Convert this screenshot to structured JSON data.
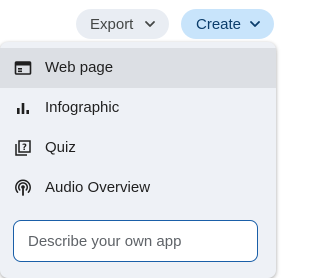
{
  "toolbar": {
    "export_label": "Export",
    "create_label": "Create"
  },
  "menu": {
    "items": [
      {
        "label": "Web page",
        "icon": "web-page-icon"
      },
      {
        "label": "Infographic",
        "icon": "bar-chart-icon"
      },
      {
        "label": "Quiz",
        "icon": "quiz-icon"
      },
      {
        "label": "Audio Overview",
        "icon": "podcast-icon"
      }
    ],
    "describe_placeholder": "Describe your own app"
  },
  "colors": {
    "create_bg": "#c8e4fb",
    "export_bg": "#e9edf3",
    "menu_bg": "#eef1f6",
    "active_item_bg": "#dcdfe4",
    "input_border": "#1a5fa8"
  }
}
